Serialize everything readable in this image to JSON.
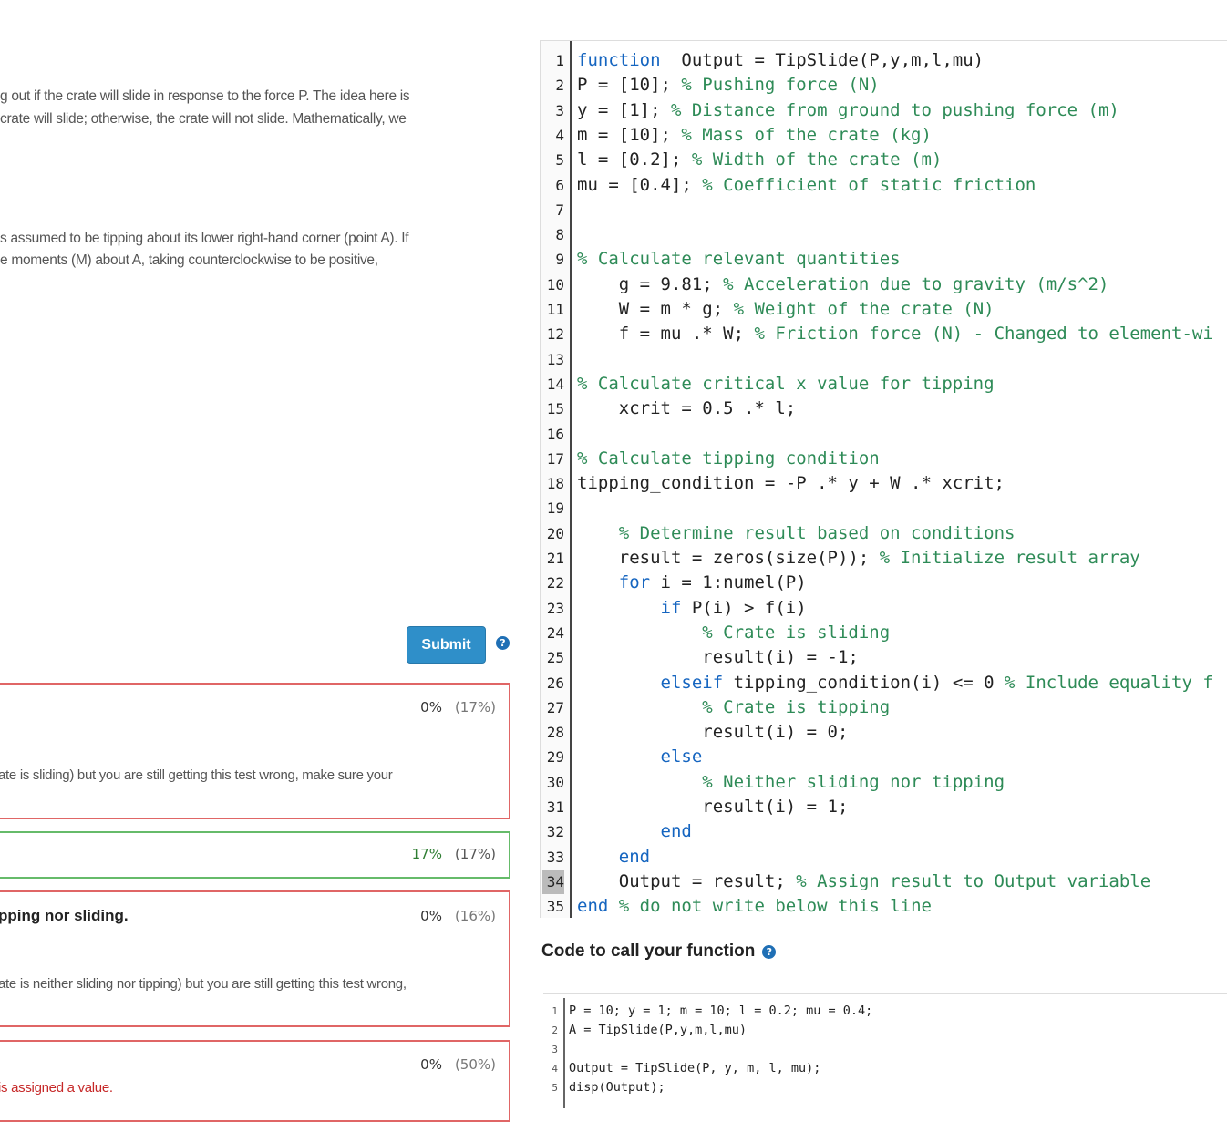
{
  "problem": {
    "paragraph1": [
      "g out if the crate will slide in response to the force P. The idea here is",
      "crate will slide; otherwise, the crate will not slide. Mathematically, we"
    ],
    "paragraph2": [
      "s assumed to be tipping about its lower right-hand corner (point A). If",
      "e moments (M) about A, taking counterclockwise to be positive,"
    ]
  },
  "submit": {
    "label": "Submit",
    "help_icon": "question-circle-icon"
  },
  "tests": [
    {
      "status": "fail",
      "title": "",
      "score": "0%",
      "weight": "(17%)",
      "message": "ate is sliding) but you are still getting this test wrong, make sure your"
    },
    {
      "status": "pass",
      "title": "",
      "score": "17%",
      "weight": "(17%)",
      "message": ""
    },
    {
      "status": "fail",
      "title": "pping nor sliding.",
      "score": "0%",
      "weight": "(16%)",
      "message": "ate is neither sliding nor tipping) but you are still getting this test wrong,"
    },
    {
      "status": "fail",
      "title": "",
      "score": "0%",
      "weight": "(50%)",
      "message": "is assigned a value."
    }
  ],
  "editor": {
    "active_line": 34,
    "lines": [
      [
        [
          "kw",
          "function"
        ],
        [
          "",
          "  Output = TipSlide(P,y,m,l,mu)"
        ]
      ],
      [
        [
          "",
          "P = [10]; "
        ],
        [
          "cm",
          "% Pushing force (N)"
        ]
      ],
      [
        [
          "",
          "y = [1]; "
        ],
        [
          "cm",
          "% Distance from ground to pushing force (m)"
        ]
      ],
      [
        [
          "",
          "m = [10]; "
        ],
        [
          "cm",
          "% Mass of the crate (kg)"
        ]
      ],
      [
        [
          "",
          "l = [0.2]; "
        ],
        [
          "cm",
          "% Width of the crate (m)"
        ]
      ],
      [
        [
          "",
          "mu = [0.4]; "
        ],
        [
          "cm",
          "% Coefficient of static friction"
        ]
      ],
      [],
      [],
      [
        [
          "cm",
          "% Calculate relevant quantities"
        ]
      ],
      [
        [
          "",
          "    g = 9.81; "
        ],
        [
          "cm",
          "% Acceleration due to gravity (m/s^2)"
        ]
      ],
      [
        [
          "",
          "    W = m * g; "
        ],
        [
          "cm",
          "% Weight of the crate (N)"
        ]
      ],
      [
        [
          "",
          "    f = mu .* W; "
        ],
        [
          "cm",
          "% Friction force (N) - Changed to element-wi"
        ]
      ],
      [],
      [
        [
          "cm",
          "% Calculate critical x value for tipping"
        ]
      ],
      [
        [
          "",
          "    xcrit = 0.5 .* l;"
        ]
      ],
      [],
      [
        [
          "cm",
          "% Calculate tipping condition"
        ]
      ],
      [
        [
          "",
          "tipping_condition = -P .* y + W .* xcrit;"
        ]
      ],
      [],
      [
        [
          "",
          "    "
        ],
        [
          "cm",
          "% Determine result based on conditions"
        ]
      ],
      [
        [
          "",
          "    result = zeros(size(P)); "
        ],
        [
          "cm",
          "% Initialize result array"
        ]
      ],
      [
        [
          "",
          "    "
        ],
        [
          "kw",
          "for"
        ],
        [
          "",
          " i = 1:numel(P)"
        ]
      ],
      [
        [
          "",
          "        "
        ],
        [
          "kw",
          "if"
        ],
        [
          "",
          " P(i) > f(i)"
        ]
      ],
      [
        [
          "",
          "            "
        ],
        [
          "cm",
          "% Crate is sliding"
        ]
      ],
      [
        [
          "",
          "            result(i) = -1;"
        ]
      ],
      [
        [
          "",
          "        "
        ],
        [
          "kw",
          "elseif"
        ],
        [
          "",
          " tipping_condition(i) <= 0 "
        ],
        [
          "cm",
          "% Include equality f"
        ]
      ],
      [
        [
          "",
          "            "
        ],
        [
          "cm",
          "% Crate is tipping"
        ]
      ],
      [
        [
          "",
          "            result(i) = 0;"
        ]
      ],
      [
        [
          "",
          "        "
        ],
        [
          "kw",
          "else"
        ]
      ],
      [
        [
          "",
          "            "
        ],
        [
          "cm",
          "% Neither sliding nor tipping"
        ]
      ],
      [
        [
          "",
          "            result(i) = 1;"
        ]
      ],
      [
        [
          "",
          "        "
        ],
        [
          "kw",
          "end"
        ]
      ],
      [
        [
          "",
          "    "
        ],
        [
          "kw",
          "end"
        ]
      ],
      [
        [
          "",
          "    Output = result; "
        ],
        [
          "cm",
          "% Assign result to Output variable"
        ]
      ],
      [
        [
          "kw",
          "end"
        ],
        [
          "",
          " "
        ],
        [
          "cm",
          "% do not write below this line"
        ]
      ]
    ]
  },
  "call_section": {
    "title": "Code to call your function",
    "help_icon": "question-circle-icon",
    "lines": [
      "P = 10; y = 1; m = 10; l = 0.2; mu = 0.4;",
      "A = TipSlide(P,y,m,l,mu)",
      "",
      "Output = TipSlide(P, y, m, l, mu);",
      "disp(Output);"
    ]
  }
}
